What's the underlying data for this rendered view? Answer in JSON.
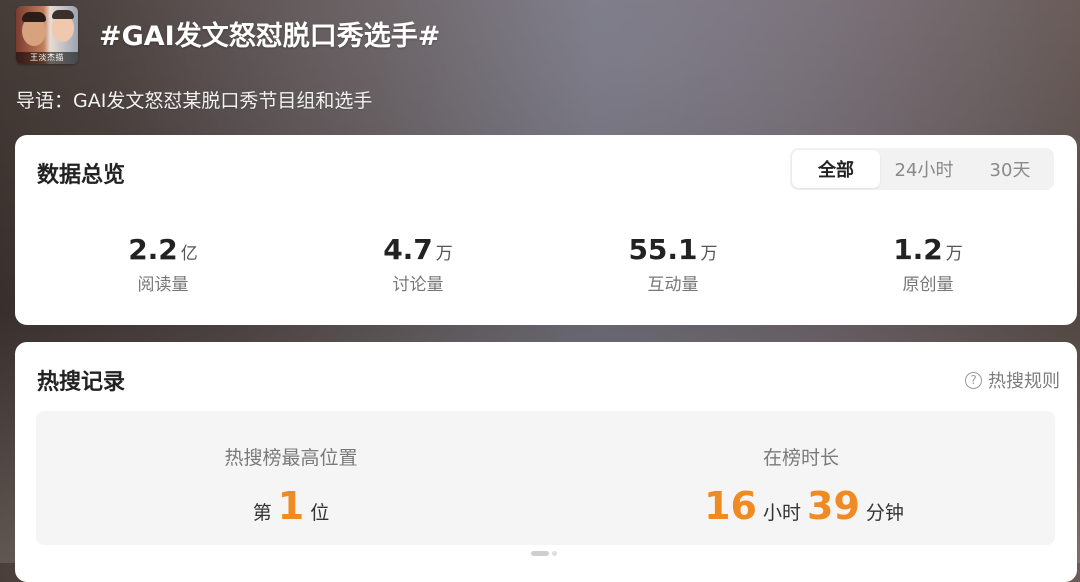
{
  "header": {
    "avatar_caption": "王淡杰描",
    "topic_title": "#GAI发文怒怼脱口秀选手#",
    "lead": "导语：GAI发文怒怼某脱口秀节目组和选手"
  },
  "overview": {
    "title": "数据总览",
    "tabs": [
      {
        "label": "全部",
        "selected": true
      },
      {
        "label": "24小时",
        "selected": false
      },
      {
        "label": "30天",
        "selected": false
      }
    ],
    "stats": [
      {
        "value": "2.2",
        "unit": "亿",
        "label": "阅读量"
      },
      {
        "value": "4.7",
        "unit": "万",
        "label": "讨论量"
      },
      {
        "value": "55.1",
        "unit": "万",
        "label": "互动量"
      },
      {
        "value": "1.2",
        "unit": "万",
        "label": "原创量"
      }
    ]
  },
  "hot_search": {
    "title": "热搜记录",
    "rules_label": "热搜规则",
    "rules_icon": "question-circle-icon",
    "peak": {
      "label": "热搜榜最高位置",
      "prefix": "第",
      "value": "1",
      "suffix": "位"
    },
    "duration": {
      "label": "在榜时长",
      "hours": "16",
      "hours_unit": "小时",
      "minutes": "39",
      "minutes_unit": "分钟"
    }
  },
  "colors": {
    "accent_orange": "#f08a23",
    "card_bg": "#ffffff",
    "panel_bg": "#f5f5f5"
  }
}
